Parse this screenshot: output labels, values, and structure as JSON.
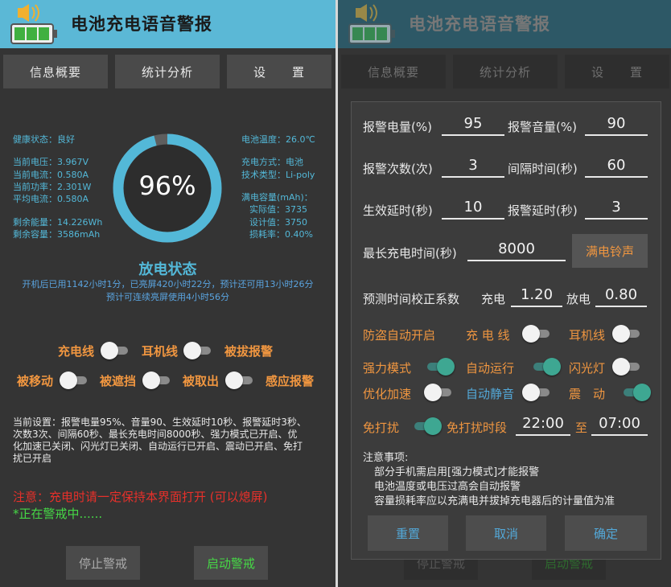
{
  "app": {
    "title": "电池充电语音警报"
  },
  "tabs": [
    "信息概要",
    "统计分析",
    "设　　置"
  ],
  "left": {
    "stats_left": [
      "健康状态：良好",
      "当前电压：3.967V",
      "当前电流：0.580A",
      "当前功率：2.301W",
      "平均电流：0.580A",
      "剩余能量：14.226Wh",
      "剩余容量：3586mAh"
    ],
    "stats_right": [
      "电池温度：26.0℃",
      "充电方式：电池",
      "技术类型：Li-poly",
      "满电容量(mAh)：",
      "实际值：3735",
      "设计值：3750",
      "损耗率：0.40%"
    ],
    "gauge": {
      "percent_label": "96%",
      "fraction": 0.96
    },
    "status_title": "放电状态",
    "status_lines": [
      "开机后已用1142小时1分，已亮屏420小时22分，预计还可用13小时26分",
      "预计可连续亮屏使用4小时56分"
    ],
    "toggles_row1": [
      {
        "label": "充电线",
        "on": false
      },
      {
        "label": "耳机线",
        "on": false
      },
      {
        "label": "被拔报警"
      }
    ],
    "toggles_row2": [
      {
        "label": "被移动",
        "on": false
      },
      {
        "label": "被遮挡",
        "on": false
      },
      {
        "label": "被取出",
        "on": false
      },
      {
        "label": "感应报警"
      }
    ],
    "settings_summary": [
      "当前设置：报警电量95%、音量90、生效延时10秒、报警延时3秒、",
      "次数3次、间隔60秒、最长充电时间8000秒、强力模式已开启、优",
      "化加速已关闭、闪光灯已关闭、自动运行已开启、震动已开启、免打",
      "扰已开启"
    ],
    "warning": "注意：充电时请一定保持本界面打开 (可以熄屏)",
    "guarding": "*正在警戒中......",
    "stop_button": "停止警戒",
    "start_button": "启动警戒",
    "colors": {
      "accent": "#53b8d8",
      "orange": "#f09640",
      "red": "#e8302a",
      "green": "#46d846"
    }
  },
  "dialog": {
    "fields": [
      {
        "label": "报警电量(%)",
        "value": "95"
      },
      {
        "label": "报警音量(%)",
        "value": "90"
      },
      {
        "label": "报警次数(次)",
        "value": "3"
      },
      {
        "label": "间隔时间(秒)",
        "value": "60"
      },
      {
        "label": "生效延时(秒)",
        "value": "10"
      },
      {
        "label": "报警延时(秒)",
        "value": "3"
      }
    ],
    "max_charge_label": "最长充电时间(秒)",
    "max_charge_value": "8000",
    "ringtone_button": "满电铃声",
    "calib_label": "预测时间校正系数",
    "charge_label": "充电",
    "charge_value": "1.20",
    "discharge_label": "放电",
    "discharge_value": "0.80",
    "row_theft": [
      {
        "label": "防盗自动开启"
      },
      {
        "label": "充 电 线",
        "on": false
      },
      {
        "label": "耳机线",
        "on": false
      }
    ],
    "row_mode": [
      {
        "label": "强力模式",
        "on": true
      },
      {
        "label": "自动运行",
        "on": true
      },
      {
        "label": "闪光灯",
        "on": false
      }
    ],
    "row_opt": [
      {
        "label": "优化加速",
        "on": false
      },
      {
        "label": "自动静音",
        "on": false
      },
      {
        "label": "震　动",
        "on": true
      }
    ],
    "dnd_label": "免打扰",
    "dnd_on": true,
    "dnd_period_label": "免打扰时段",
    "dnd_start": "22:00",
    "dnd_to": "至",
    "dnd_end": "07:00",
    "notes_title": "注意事项:",
    "notes": [
      "部分手机需启用[强力模式]才能报警",
      "电池温度或电压过高会自动报警",
      "容量损耗率应以充满电并拔掉充电器后的计量值为准"
    ],
    "buttons": {
      "reset": "重置",
      "cancel": "取消",
      "ok": "确定"
    }
  }
}
